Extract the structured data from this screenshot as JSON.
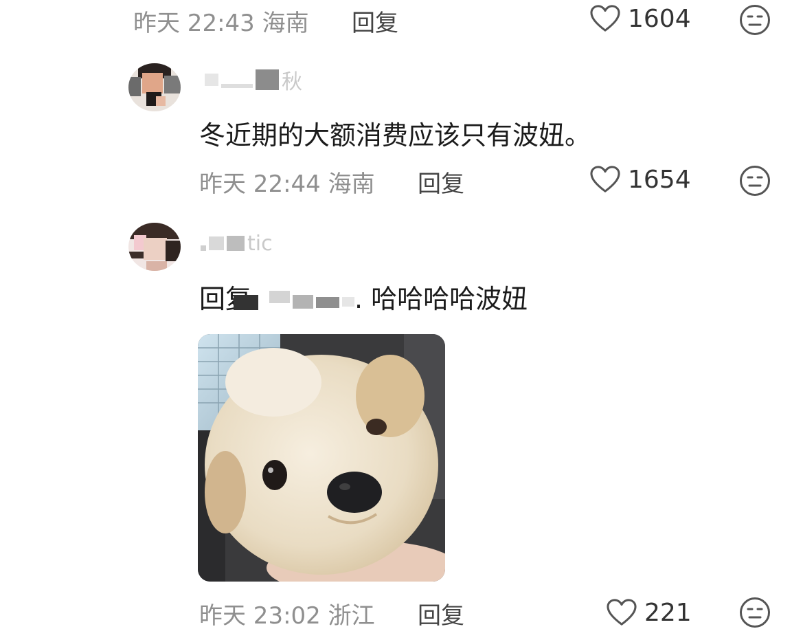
{
  "comments": [
    {
      "meta": "昨天 22:43 海南",
      "reply_label": "回复",
      "likes": "1604"
    },
    {
      "username_visible": "秋",
      "text": "冬近期的大额消费应该只有波妞。",
      "meta": "昨天 22:44 海南",
      "reply_label": "回复",
      "likes": "1654"
    },
    {
      "username_visible": "tic",
      "text_prefix": "回复",
      "text_suffix": ". 哈哈哈哈波妞",
      "meta": "昨天 23:02 浙江",
      "reply_label": "回复",
      "likes": "221"
    }
  ],
  "icons": {
    "like": "heart-outline-icon",
    "dislike": "meh-face-icon"
  },
  "colors": {
    "meta_text": "#8f8f8f",
    "icon_stroke": "#555555"
  }
}
